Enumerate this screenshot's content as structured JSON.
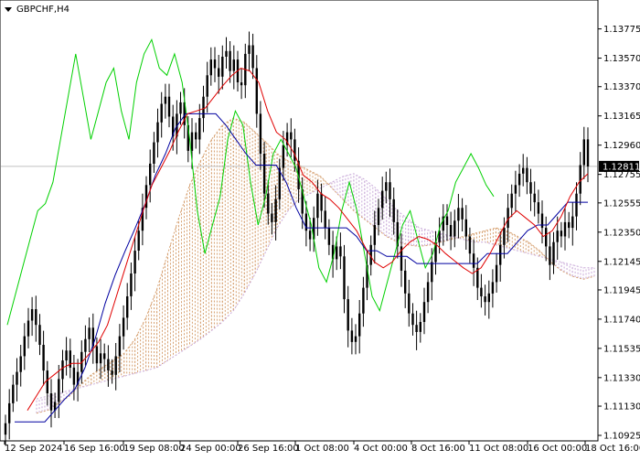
{
  "chart_data": {
    "type": "candlestick",
    "title": "GBPCHF,H4",
    "current_price": "1.12811",
    "current_price_value": 1.12811,
    "ylim": [
      1.10925,
      1.13875
    ],
    "y_ticks": [
      "1.13775",
      "1.13570",
      "1.13370",
      "1.13165",
      "1.12960",
      "1.12755",
      "1.12555",
      "1.12350",
      "1.12145",
      "1.11945",
      "1.11740",
      "1.11535",
      "1.11330",
      "1.11130",
      "1.10925"
    ],
    "x_ticks": [
      "12 Sep 2024",
      "16 Sep 16:00",
      "19 Sep 08:00",
      "24 Sep 00:00",
      "26 Sep 16:00",
      "1 Oct 08:00",
      "4 Oct 00:00",
      "8 Oct 16:00",
      "11 Oct 08:00",
      "16 Oct 00:00",
      "18 Oct 16:00"
    ],
    "grid": false,
    "colors": {
      "candles": "#000000",
      "tenkan_sen": "#e00000",
      "kijun_sen": "#0000a0",
      "chikou_span": "#00d000",
      "kumo_bullish": "#d6a070",
      "kumo_bearish": "#c8a8d8",
      "price_line": "#c0c0c0"
    },
    "candles_close": [
      1.1101,
      1.1115,
      1.1128,
      1.1137,
      1.1148,
      1.1162,
      1.1173,
      1.1181,
      1.117,
      1.1156,
      1.1138,
      1.1122,
      1.111,
      1.1116,
      1.1132,
      1.1145,
      1.1152,
      1.114,
      1.1128,
      1.1137,
      1.1151,
      1.116,
      1.1168,
      1.1155,
      1.1143,
      1.115,
      1.1146,
      1.1138,
      1.1135,
      1.1148,
      1.1162,
      1.1175,
      1.119,
      1.1206,
      1.1222,
      1.1236,
      1.1252,
      1.1268,
      1.1283,
      1.1298,
      1.1312,
      1.1325,
      1.133,
      1.1316,
      1.1302,
      1.1318,
      1.1326,
      1.131,
      1.1292,
      1.1305,
      1.13,
      1.1315,
      1.133,
      1.1345,
      1.1356,
      1.135,
      1.1344,
      1.1358,
      1.1362,
      1.1348,
      1.1356,
      1.134,
      1.1338,
      1.136,
      1.1366,
      1.135,
      1.1318,
      1.129,
      1.1262,
      1.1248,
      1.1242,
      1.1258,
      1.128,
      1.1296,
      1.1305,
      1.13,
      1.1285,
      1.1265,
      1.1248,
      1.1236,
      1.123,
      1.1245,
      1.1262,
      1.125,
      1.1238,
      1.1226,
      1.1216,
      1.1225,
      1.1218,
      1.1188,
      1.1166,
      1.1158,
      1.1162,
      1.1178,
      1.1196,
      1.1212,
      1.1226,
      1.124,
      1.1252,
      1.1264,
      1.127,
      1.1258,
      1.1242,
      1.1225,
      1.1208,
      1.1192,
      1.1178,
      1.117,
      1.1165,
      1.1172,
      1.1186,
      1.12,
      1.1214,
      1.1228,
      1.1236,
      1.1246,
      1.124,
      1.1232,
      1.1243,
      1.1252,
      1.1244,
      1.1232,
      1.122,
      1.121,
      1.1196,
      1.119,
      1.1186,
      1.1192,
      1.12,
      1.1212,
      1.1226,
      1.1238,
      1.1252,
      1.1262,
      1.1268,
      1.1276,
      1.128,
      1.127,
      1.1262,
      1.1256,
      1.1248,
      1.1238,
      1.1225,
      1.1212,
      1.1228,
      1.1236,
      1.1232,
      1.1242,
      1.1238,
      1.1246,
      1.1262,
      1.1282,
      1.13,
      1.1281
    ],
    "tenkan_sen": [
      1.111,
      1.112,
      1.113,
      1.1135,
      1.114,
      1.1143,
      1.1143,
      1.115,
      1.1158,
      1.117,
      1.119,
      1.121,
      1.123,
      1.125,
      1.1268,
      1.128,
      1.1292,
      1.1306,
      1.1318,
      1.132,
      1.1322,
      1.133,
      1.1338,
      1.1345,
      1.135,
      1.1348,
      1.134,
      1.132,
      1.1305,
      1.13,
      1.129,
      1.1275,
      1.127,
      1.1262,
      1.1258,
      1.1252,
      1.1244,
      1.1236,
      1.1224,
      1.1214,
      1.121,
      1.1214,
      1.1222,
      1.1228,
      1.1232,
      1.123,
      1.1226,
      1.122,
      1.1215,
      1.121,
      1.1206,
      1.121,
      1.122,
      1.1232,
      1.1244,
      1.125,
      1.1245,
      1.124,
      1.1232,
      1.1236,
      1.1246,
      1.126,
      1.127,
      1.1276
    ],
    "kijun_sen": [
      1.1102,
      1.1102,
      1.1102,
      1.1102,
      1.111,
      1.1118,
      1.1125,
      1.114,
      1.116,
      1.1185,
      1.1205,
      1.1222,
      1.1238,
      1.1255,
      1.1275,
      1.129,
      1.1308,
      1.1318,
      1.1318,
      1.1318,
      1.1318,
      1.131,
      1.13,
      1.129,
      1.1282,
      1.1282,
      1.1282,
      1.127,
      1.1252,
      1.1238,
      1.1238,
      1.1238,
      1.1238,
      1.1238,
      1.1232,
      1.1222,
      1.1222,
      1.1218,
      1.1218,
      1.1218,
      1.1213,
      1.1213,
      1.1213,
      1.1213,
      1.1213,
      1.1213,
      1.1213,
      1.122,
      1.122,
      1.122,
      1.1228,
      1.1236,
      1.124,
      1.124,
      1.1248,
      1.1256,
      1.1256,
      1.1256
    ],
    "chikou_span": [
      1.117,
      1.119,
      1.121,
      1.123,
      1.125,
      1.1255,
      1.127,
      1.13,
      1.133,
      1.136,
      1.133,
      1.13,
      1.132,
      1.134,
      1.135,
      1.132,
      1.13,
      1.134,
      1.136,
      1.137,
      1.135,
      1.1345,
      1.136,
      1.134,
      1.13,
      1.125,
      1.122,
      1.124,
      1.126,
      1.13,
      1.132,
      1.131,
      1.127,
      1.124,
      1.126,
      1.129,
      1.13,
      1.129,
      1.128,
      1.126,
      1.124,
      1.121,
      1.12,
      1.122,
      1.125,
      1.127,
      1.125,
      1.122,
      1.119,
      1.118,
      1.12,
      1.122,
      1.124,
      1.125,
      1.123,
      1.121,
      1.122,
      1.124,
      1.125,
      1.127,
      1.128,
      1.129,
      1.128,
      1.1268,
      1.126
    ],
    "senkou_span_a": [
      1.1108,
      1.111,
      1.1115,
      1.112,
      1.1128,
      1.1135,
      1.114,
      1.1145,
      1.115,
      1.116,
      1.1175,
      1.1195,
      1.122,
      1.1245,
      1.1268,
      1.1285,
      1.13,
      1.131,
      1.1315,
      1.1312,
      1.1305,
      1.1298,
      1.129,
      1.1285,
      1.1282,
      1.1278,
      1.1274,
      1.1266,
      1.1258,
      1.125,
      1.1244,
      1.1238,
      1.1232,
      1.1228,
      1.1226,
      1.1225,
      1.1226,
      1.1228,
      1.123,
      1.1232,
      1.1234,
      1.1236,
      1.1238,
      1.1236,
      1.1232,
      1.1228,
      1.1222,
      1.1214,
      1.1208,
      1.1204,
      1.1202,
      1.1204
    ],
    "senkou_span_b": [
      1.1118,
      1.112,
      1.1122,
      1.1124,
      1.1126,
      1.1128,
      1.113,
      1.1132,
      1.1134,
      1.1136,
      1.1138,
      1.114,
      1.1145,
      1.115,
      1.1155,
      1.116,
      1.1166,
      1.1172,
      1.118,
      1.1192,
      1.1206,
      1.1222,
      1.1238,
      1.125,
      1.1258,
      1.1262,
      1.1266,
      1.127,
      1.1274,
      1.1276,
      1.1272,
      1.1266,
      1.1258,
      1.125,
      1.1244,
      1.1238,
      1.1236,
      1.1234,
      1.1232,
      1.123,
      1.1228,
      1.1228,
      1.1226,
      1.1224,
      1.1222,
      1.122,
      1.1218,
      1.1216,
      1.1214,
      1.1212,
      1.121,
      1.121
    ]
  }
}
